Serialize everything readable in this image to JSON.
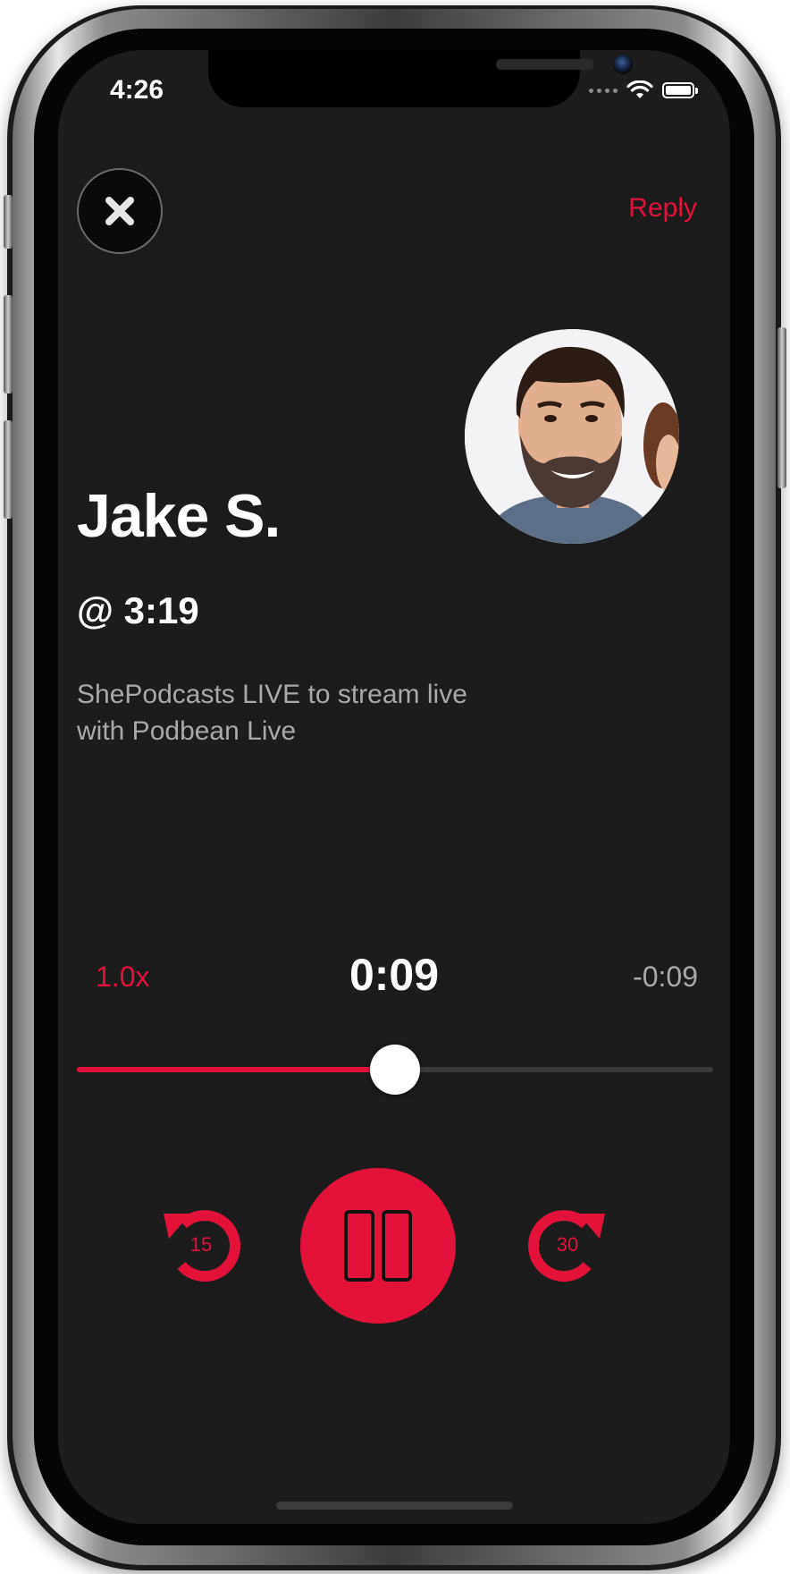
{
  "status_bar": {
    "time": "4:26"
  },
  "header": {
    "reply_label": "Reply"
  },
  "clip": {
    "author": "Jake S.",
    "timestamp": "@ 3:19",
    "description": "ShePodcasts LIVE to stream live with Podbean Live"
  },
  "player": {
    "speed": "1.0x",
    "elapsed": "0:09",
    "remaining": "-0:09",
    "progress_fraction": 0.5,
    "skip_back_seconds": "15",
    "skip_forward_seconds": "30"
  },
  "colors": {
    "accent": "#e2123a",
    "background": "#1c1c1d",
    "secondary_text": "#a9a9aa"
  }
}
